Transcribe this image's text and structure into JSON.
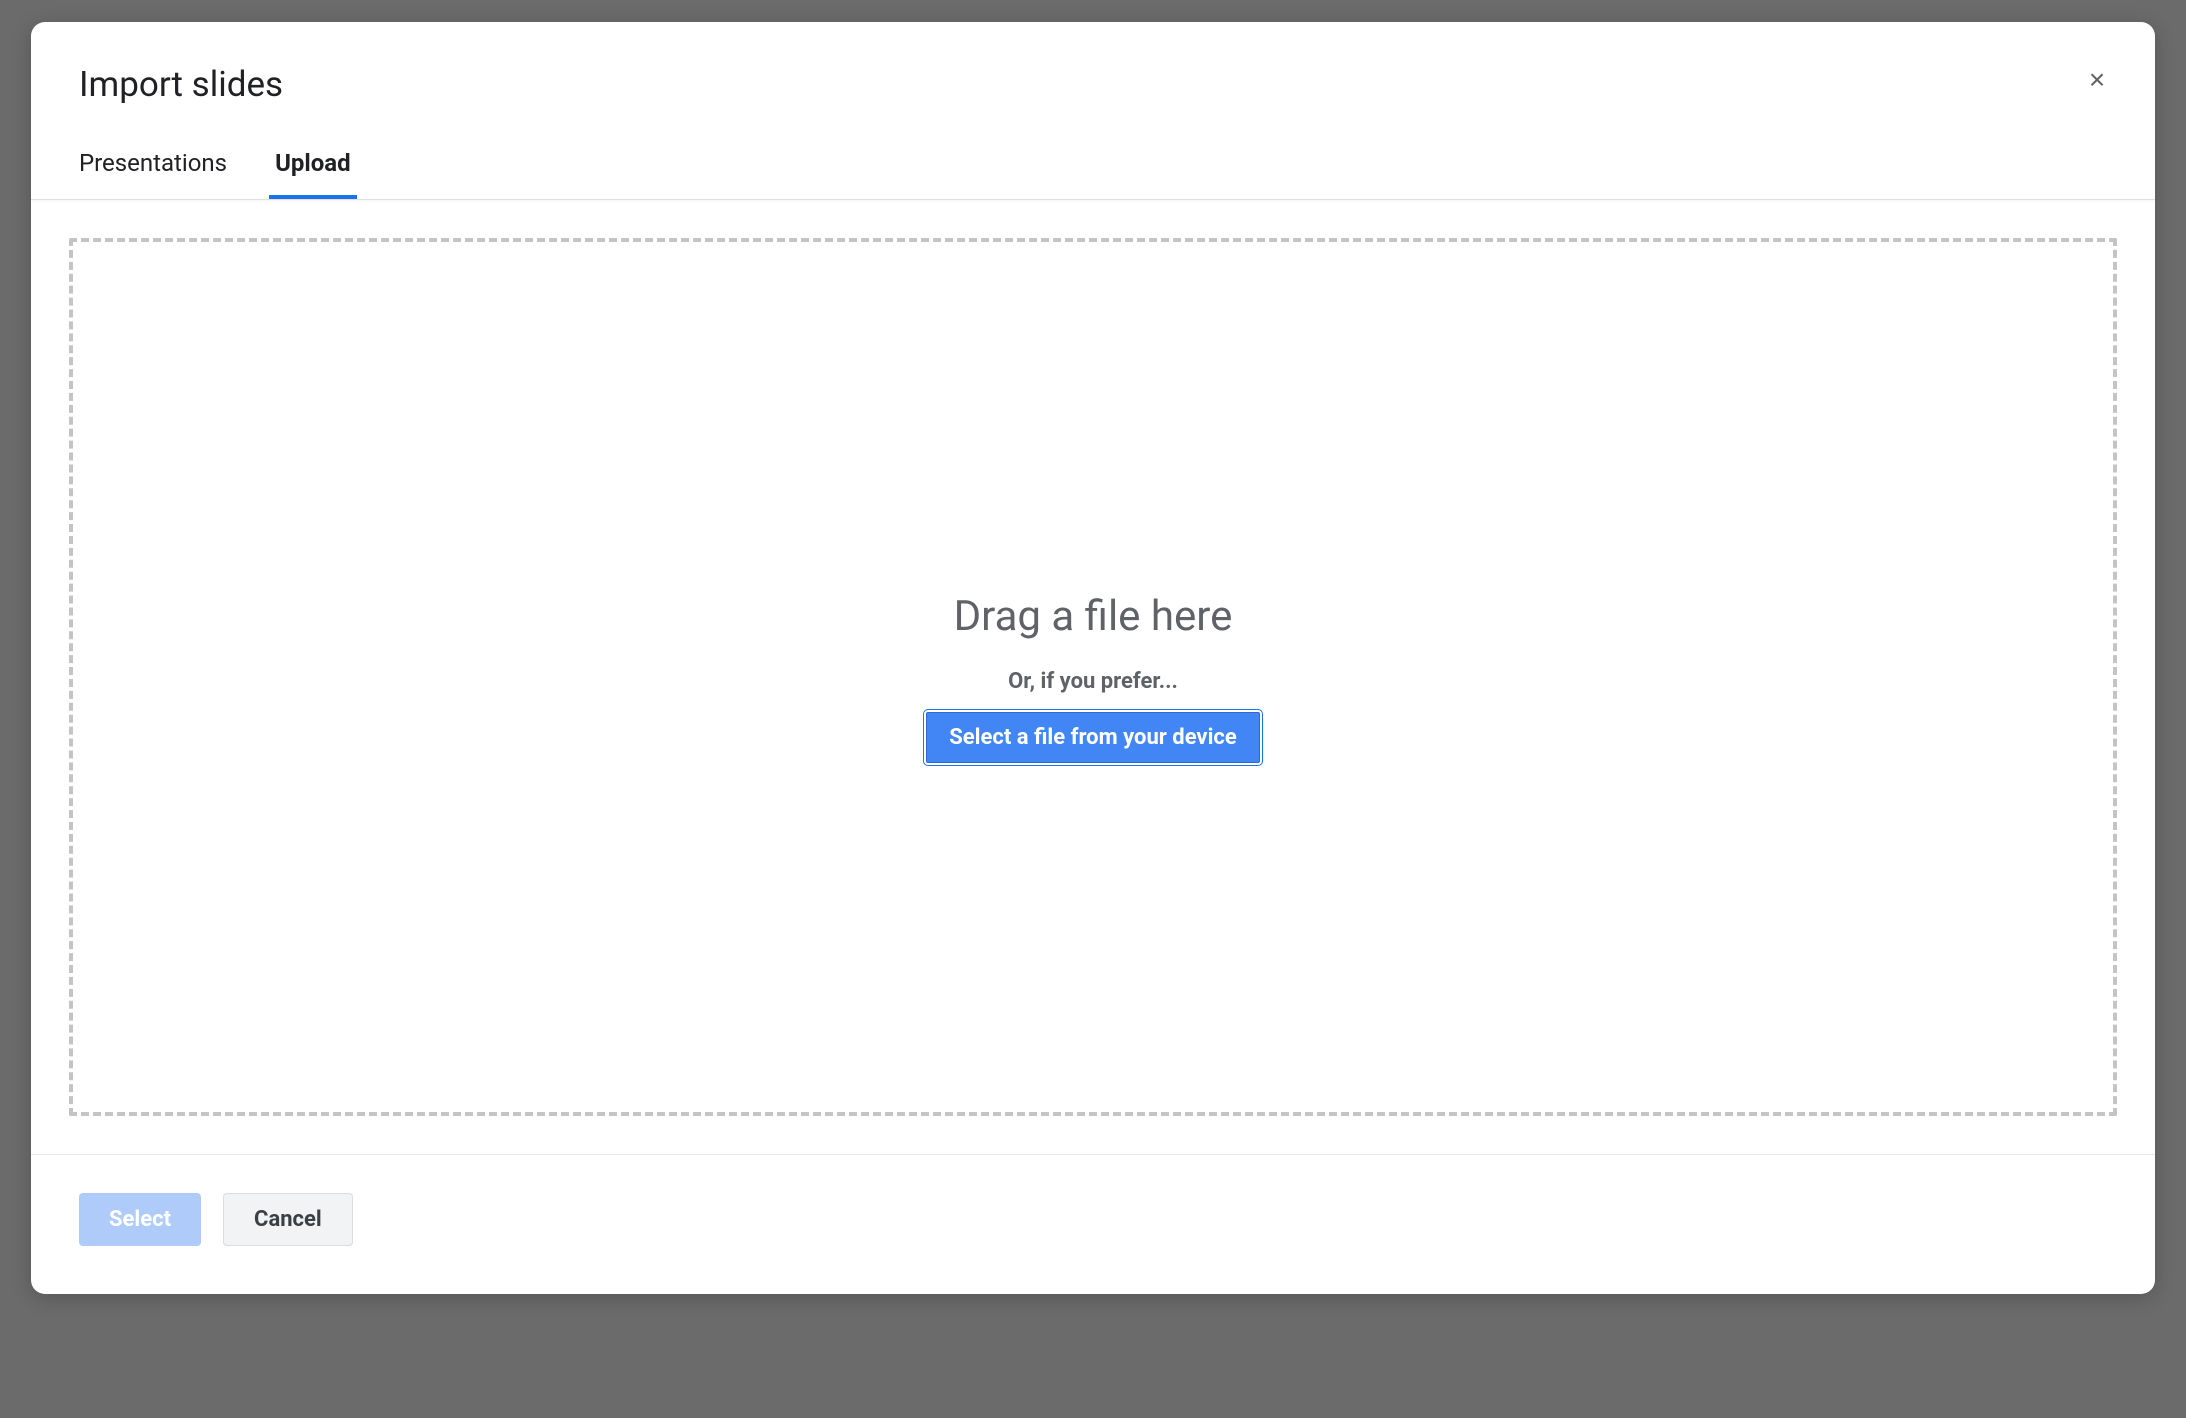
{
  "modal": {
    "title": "Import slides",
    "close_glyph": "×",
    "tabs": [
      {
        "label": "Presentations",
        "active": false
      },
      {
        "label": "Upload",
        "active": true
      }
    ],
    "dropzone": {
      "drag_text": "Drag a file here",
      "prefer_text": "Or, if you prefer...",
      "select_file_label": "Select a file from your device"
    },
    "footer": {
      "select_label": "Select",
      "cancel_label": "Cancel"
    }
  }
}
